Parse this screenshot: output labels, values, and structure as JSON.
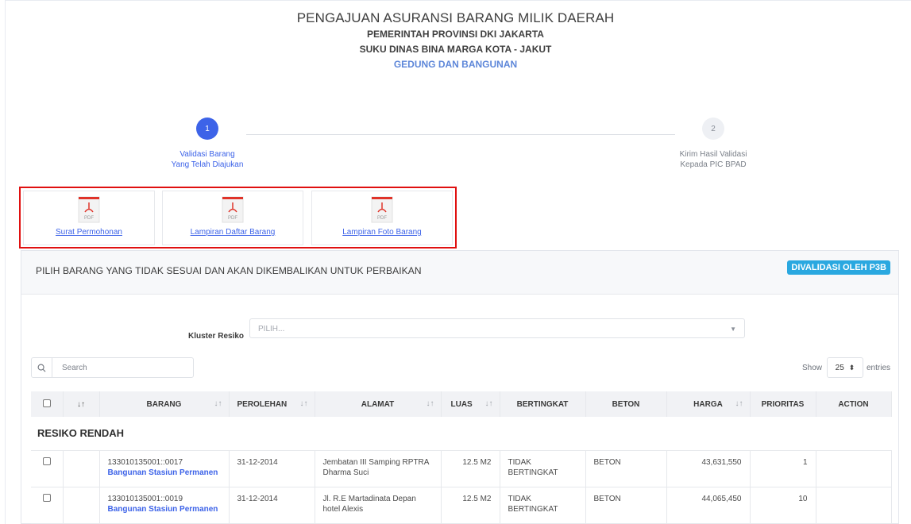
{
  "header": {
    "title": "PENGAJUAN ASURANSI BARANG MILIK DAERAH",
    "line1": "PEMERINTAH PROVINSI DKI JAKARTA",
    "line2": "SUKU DINAS BINA MARGA KOTA - JAKUT",
    "category": "GEDUNG DAN BANGUNAN"
  },
  "stepper": [
    {
      "number": "1",
      "label_line1": "Validasi Barang",
      "label_line2": "Yang Telah Diajukan",
      "active": true
    },
    {
      "number": "2",
      "label_line1": "Kirim Hasil Validasi",
      "label_line2": "Kepada PIC BPAD",
      "active": false
    }
  ],
  "documents": [
    {
      "icon": "pdf-icon",
      "icon_text": "PDF",
      "link": "Surat Permohonan"
    },
    {
      "icon": "pdf-icon",
      "icon_text": "PDF",
      "link": "Lampiran Daftar Barang"
    },
    {
      "icon": "pdf-icon",
      "icon_text": "PDF",
      "link": "Lampiran Foto Barang"
    }
  ],
  "panel": {
    "title": "PILIH BARANG YANG TIDAK SESUAI DAN AKAN DIKEMBALIKAN UNTUK PERBAIKAN",
    "badge": "DIVALIDASI OLEH P3B"
  },
  "filter": {
    "kluster_label": "Kluster Resiko",
    "kluster_placeholder": "PILIH..."
  },
  "search": {
    "placeholder": "Search"
  },
  "page_length": {
    "show_label": "Show",
    "value": "25",
    "entries_label": "entries"
  },
  "table": {
    "headers": [
      "BARANG",
      "PEROLEHAN",
      "ALAMAT",
      "LUAS",
      "BERTINGKAT",
      "BETON",
      "HARGA",
      "PRIORITAS",
      "ACTION"
    ],
    "group_label": "RESIKO RENDAH",
    "rows": [
      {
        "code": "133010135001::0017",
        "name": "Bangunan Stasiun Permanen",
        "perolehan": "31-12-2014",
        "alamat": "Jembatan III Samping RPTRA Dharma Suci",
        "luas": "12.5 M2",
        "bertingkat": "TIDAK BERTINGKAT",
        "beton": "BETON",
        "harga": "43,631,550",
        "prioritas": "1"
      },
      {
        "code": "133010135001::0019",
        "name": "Bangunan Stasiun Permanen",
        "perolehan": "31-12-2014",
        "alamat": "Jl. R.E Martadinata Depan hotel Alexis",
        "luas": "12.5 M2",
        "bertingkat": "TIDAK BERTINGKAT",
        "beton": "BETON",
        "harga": "44,065,450",
        "prioritas": "10"
      }
    ]
  },
  "colors": {
    "accent_blue": "#3d63e8",
    "highlight_red": "#e01010",
    "badge_blue": "#2aa8e0",
    "pdf_red": "#e0342a"
  }
}
